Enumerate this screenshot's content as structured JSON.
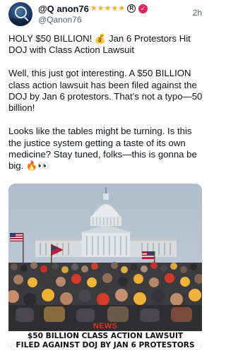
{
  "post": {
    "display_name": "@Q anon76",
    "stars": [
      "★",
      "★",
      "★",
      "★",
      "★"
    ],
    "reg_mark": "R",
    "verified_mark": "✓",
    "handle": "@Qanon76",
    "timestamp": "2h",
    "paragraphs": [
      "HOLY $50 BILLION! 💰 Jan 6 Protestors Hit DOJ with Class Action Lawsuit",
      "Well, this just got interesting. A $50 BILLION class action lawsuit has been filed against the DOJ by Jan 6 protestors. That’s not a typo—50 billion!",
      "Looks like the tables might be turning. Is this the justice system getting a taste of its own medicine? Stay tuned, folks—this is gonna be big. 🔥👀"
    ]
  },
  "media": {
    "news_label": "NEWS",
    "caption_line1": "$50 BILLION CLASS ACTION LAWSUIT",
    "caption_line2": "FILED AGAINST DOJ BY JAN 6 PROTESTORS"
  },
  "colors": {
    "accent_news": "#e0301e",
    "star": "#f4b400",
    "verified_badge": "#e0245e"
  }
}
